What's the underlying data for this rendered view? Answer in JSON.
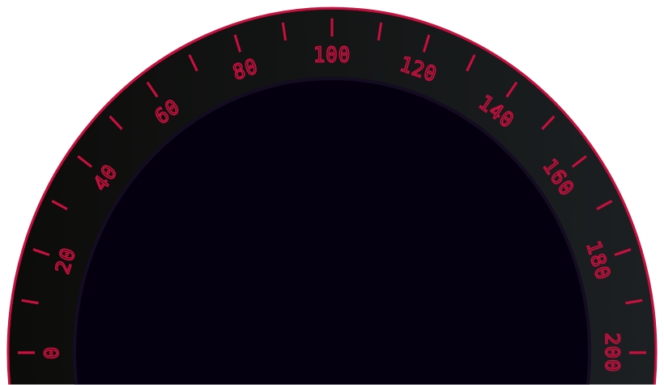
{
  "gauge": {
    "min": 0,
    "max": 200,
    "minor_step": 10,
    "labels": [
      "0",
      "20",
      "40",
      "60",
      "80",
      "100",
      "120",
      "140",
      "160",
      "180",
      "200"
    ],
    "colors": {
      "accent": "#c8103e",
      "bezel_left": "#0c0c0a",
      "bezel_right": "#1c2022",
      "face": "#05000f"
    }
  }
}
